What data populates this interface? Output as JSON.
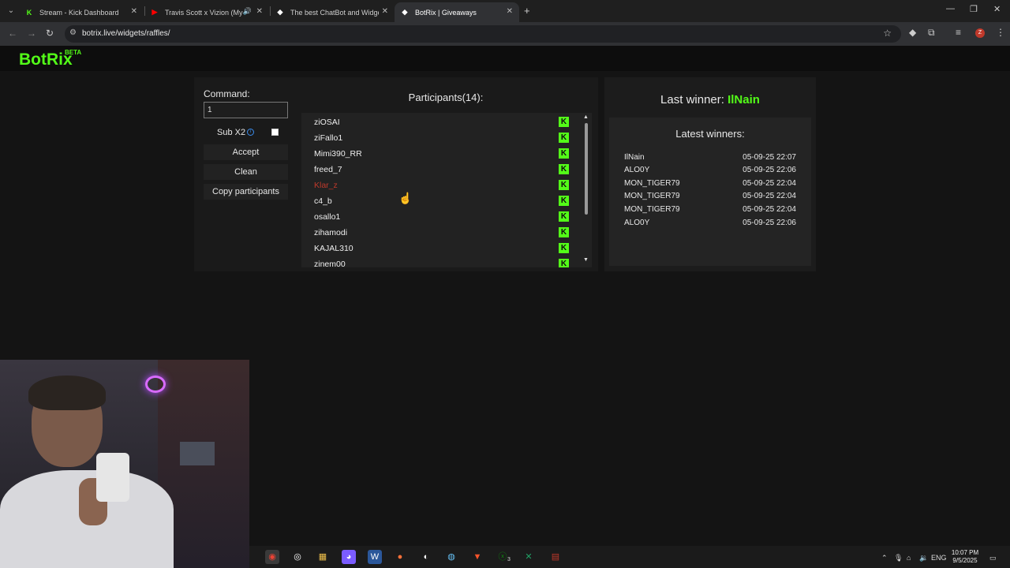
{
  "browser": {
    "tabs": [
      {
        "label": "Stream - Kick Dashboard",
        "favicon": "kick-icon",
        "active": false
      },
      {
        "label": "Travis Scott x Vizion (My Eye...",
        "favicon": "youtube-icon",
        "active": false
      },
      {
        "label": "The best ChatBot and Widgets",
        "favicon": "botrix-icon",
        "active": false
      },
      {
        "label": "BotRix | Giveaways",
        "favicon": "botrix-icon",
        "active": true
      }
    ],
    "url": "botrix.live/widgets/raffles/",
    "profile_initial": "Z"
  },
  "header": {
    "logo": "BotRix",
    "badge": "BETA"
  },
  "controls": {
    "command_label": "Command:",
    "command_value": "1",
    "sub_label": "Sub X2",
    "sub_checked": false,
    "accept_label": "Accept",
    "clean_label": "Clean",
    "copy_label": "Copy participants"
  },
  "participants": {
    "title": "Participants(14):",
    "items": [
      {
        "name": "ziOSAI",
        "flagged": false
      },
      {
        "name": "ziFallo1",
        "flagged": false
      },
      {
        "name": "Mimi390_RR",
        "flagged": false
      },
      {
        "name": "freed_7",
        "flagged": false
      },
      {
        "name": "Klar_z",
        "flagged": true
      },
      {
        "name": "c4_b",
        "flagged": false
      },
      {
        "name": "osallo1",
        "flagged": false
      },
      {
        "name": "zihamodi",
        "flagged": false
      },
      {
        "name": "KAJAL310",
        "flagged": false
      },
      {
        "name": "zinem00",
        "flagged": false
      }
    ],
    "platform_icon": "K"
  },
  "winners": {
    "last_winner_label": "Last winner:",
    "last_winner_name": "IlNain",
    "latest_title": "Latest winners:",
    "rows": [
      {
        "name": "IlNain",
        "date": "05-09-25 22:07"
      },
      {
        "name": "ALO0Y",
        "date": "05-09-25 22:06"
      },
      {
        "name": "MON_TIGER79",
        "date": "05-09-25 22:04"
      },
      {
        "name": "MON_TIGER79",
        "date": "05-09-25 22:04"
      },
      {
        "name": "MON_TIGER79",
        "date": "05-09-25 22:04"
      },
      {
        "name": "ALO0Y",
        "date": "05-09-25 22:06"
      }
    ]
  },
  "taskbar": {
    "language": "ENG",
    "time": "10:07 PM",
    "date": "9/5/2025",
    "xbox_badge": "3"
  },
  "colors": {
    "brand": "#53fc18",
    "flagged": "#c0392b",
    "background": "#141414"
  }
}
